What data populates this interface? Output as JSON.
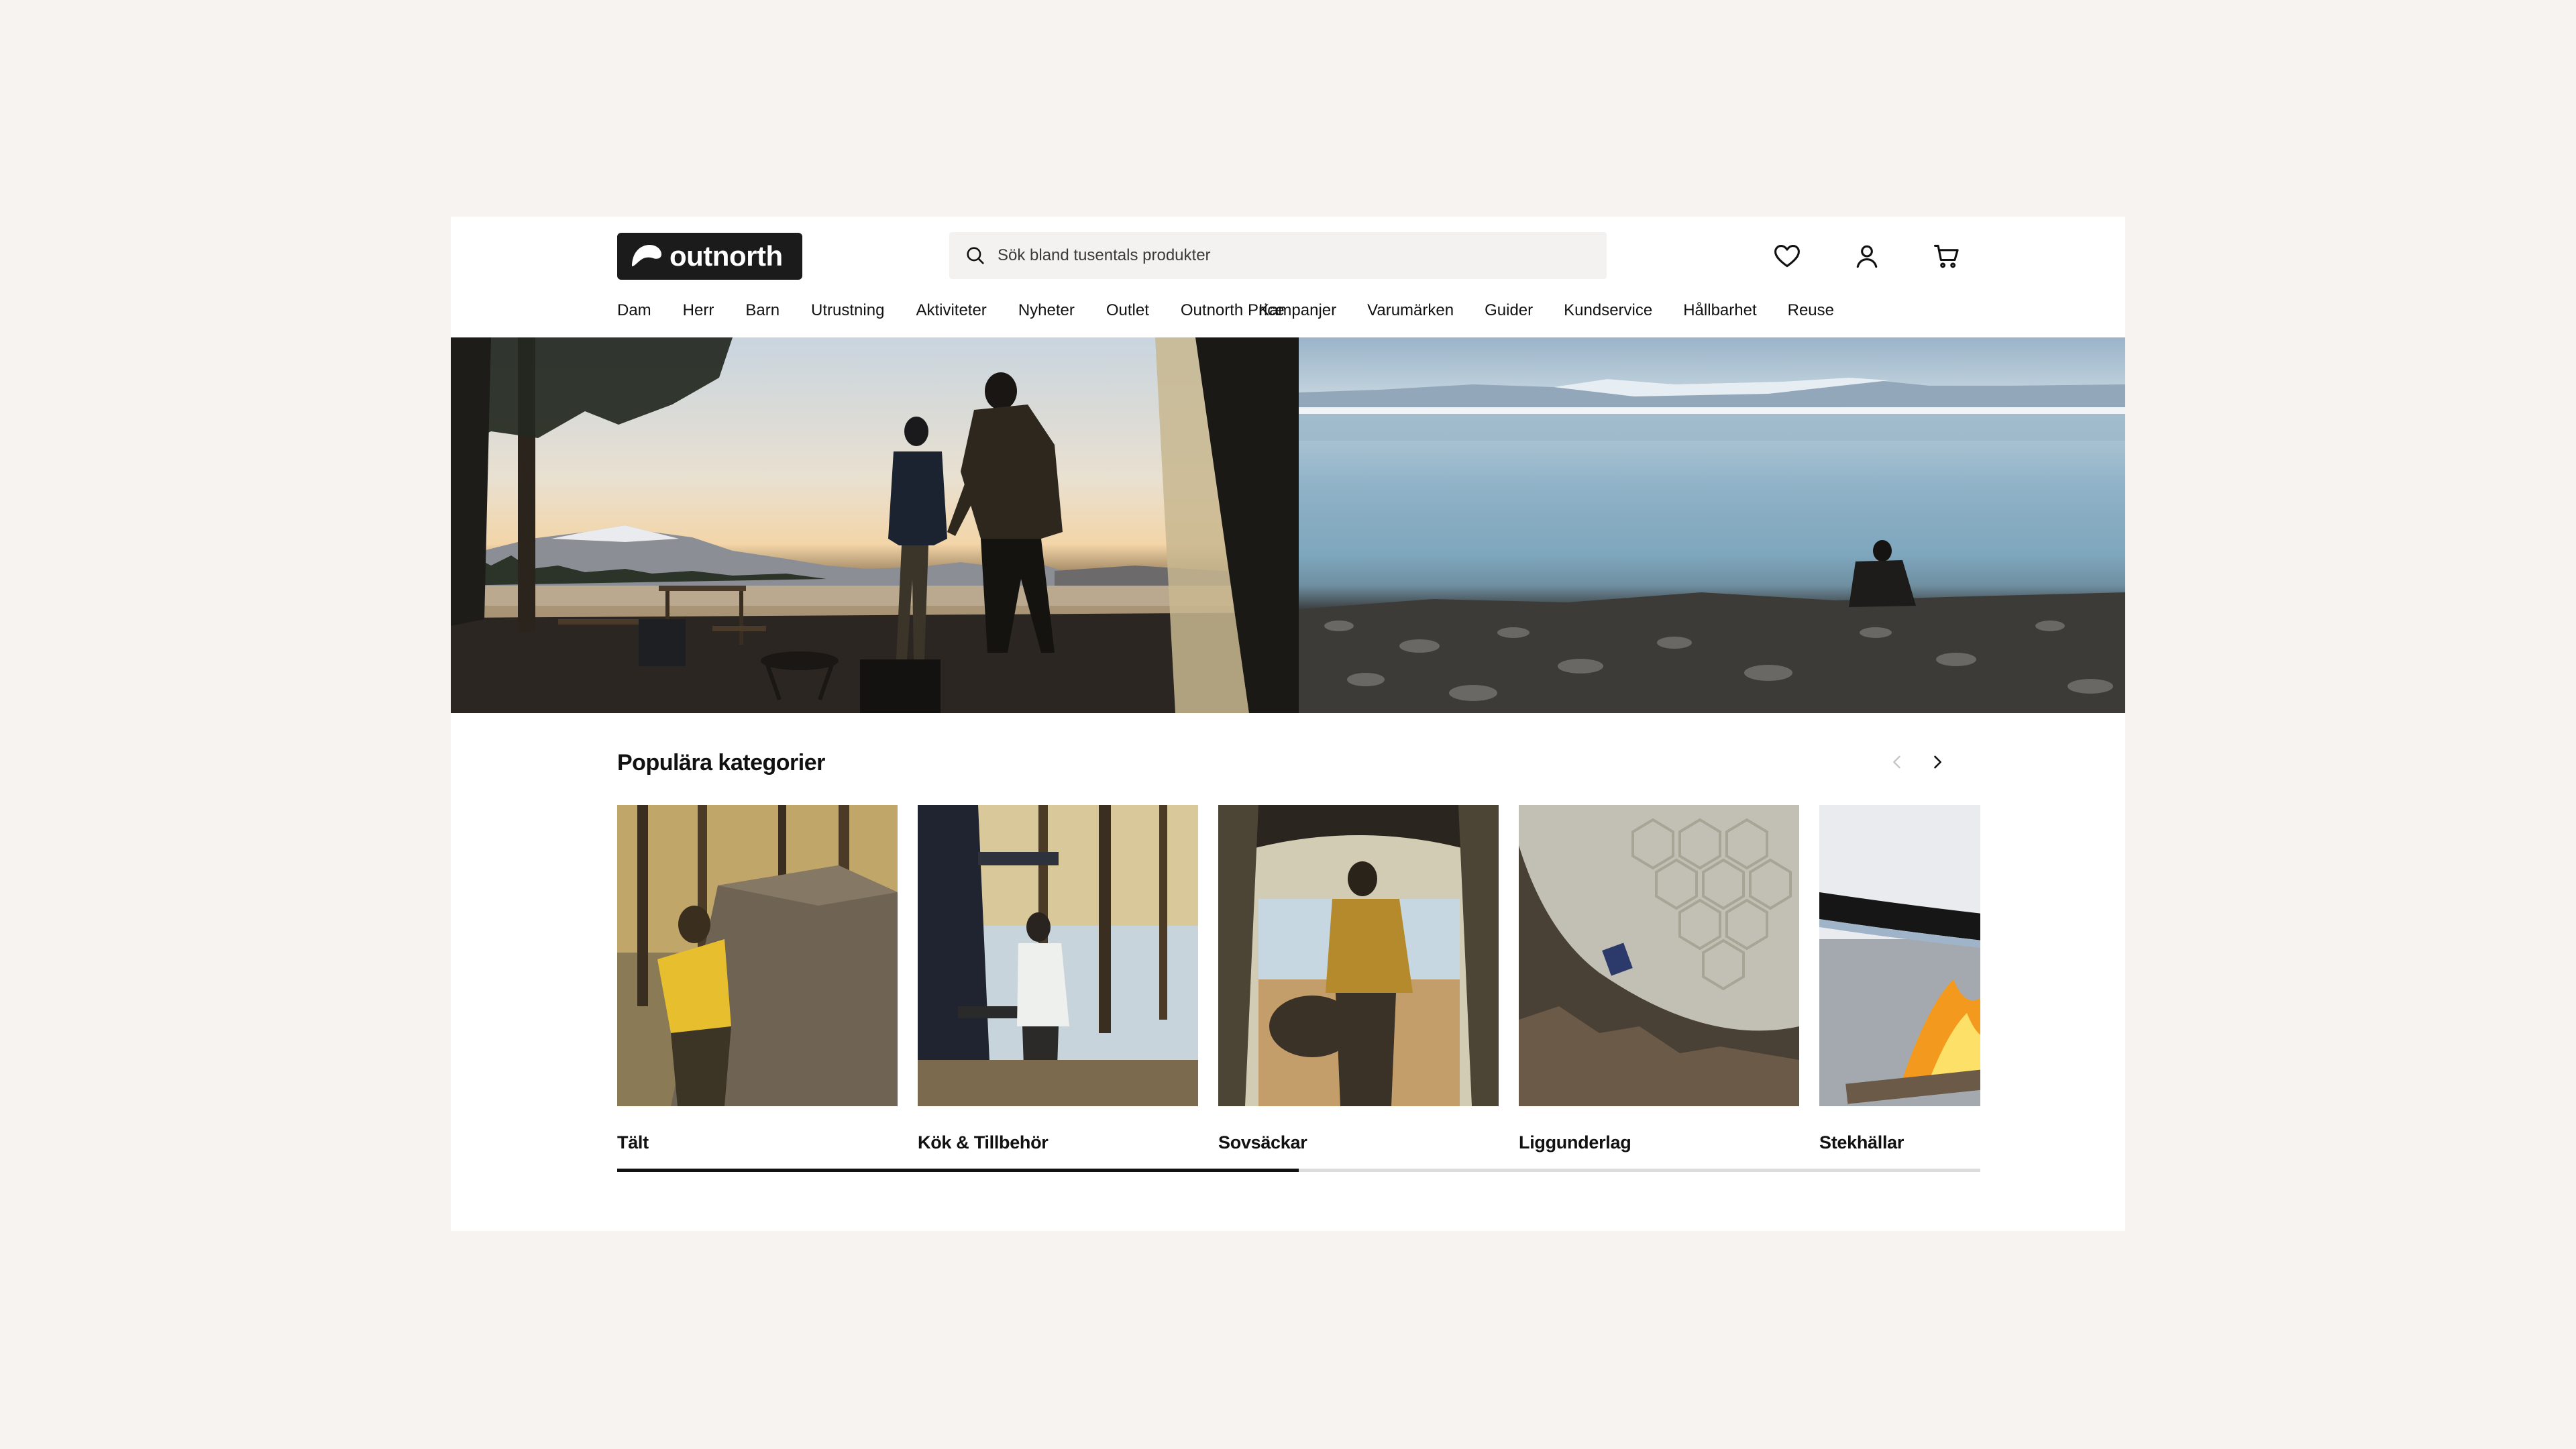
{
  "brand": {
    "name": "outnorth"
  },
  "search": {
    "placeholder": "Sök bland tusentals produkter"
  },
  "nav": {
    "left": [
      "Dam",
      "Herr",
      "Barn",
      "Utrustning",
      "Aktiviteter",
      "Nyheter",
      "Outlet",
      "Outnorth Price"
    ],
    "right": [
      "Kampanjer",
      "Varumärken",
      "Guider",
      "Kundservice",
      "Hållbarhet",
      "Reuse"
    ]
  },
  "header_icons": [
    "heart-icon",
    "user-icon",
    "cart-icon"
  ],
  "categories": {
    "title": "Populära kategorier",
    "items": [
      {
        "label": "Tält"
      },
      {
        "label": "Kök & Tillbehör"
      },
      {
        "label": "Sovsäckar"
      },
      {
        "label": "Liggunderlag"
      },
      {
        "label": "Stekhällar"
      }
    ],
    "progress": 0.5
  },
  "colors": {
    "background": "#f6f3f1",
    "logo_bg": "#1b1b1b",
    "search_bg": "#f4f2f1",
    "text": "#111111",
    "progress_track": "#dcdcdc"
  }
}
